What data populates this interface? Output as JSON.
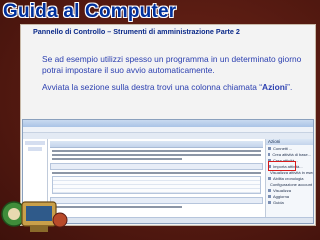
{
  "slide": {
    "title": "Guida al Computer",
    "subtitle": "Pannello di Controllo – Strumenti di amministrazione Parte 2",
    "paragraph1": "Se ad esempio utilizzi spesso un programma in un determinato giorno potrai impostare il suo avvio automaticamente.",
    "paragraph2_prefix": "Avviata la sezione sulla destra trovi una colonna chiamata “",
    "paragraph2_bold": "Azioni",
    "paragraph2_suffix": "”."
  },
  "screenshot": {
    "actions_header": "Azioni",
    "action_items": [
      "Connetti ...",
      "Crea attività di base...",
      "Crea attività...",
      "Importa attività...",
      "Visualizza attività in esecuzione",
      "Abilita cronologia",
      "Configurazione account servizio AT",
      "Visualizza",
      "Aggiorna",
      "Guida"
    ]
  },
  "colors": {
    "background": "#5a1c14",
    "title": "#00309c",
    "text": "#2b3fb0",
    "highlight": "#d81a1a"
  }
}
